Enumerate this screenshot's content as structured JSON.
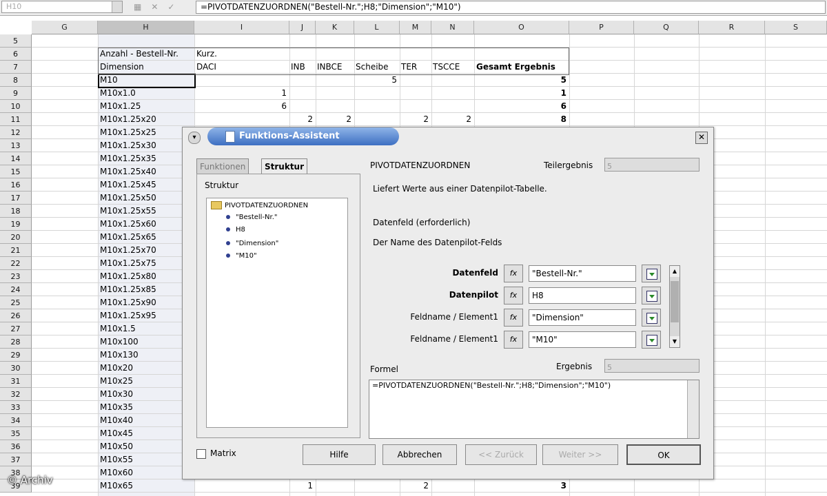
{
  "toolbar": {
    "namebox": "H10",
    "formula": "=PIVOTDATENZUORDNEN(\"Bestell-Nr.\";H8;\"Dimension\";\"M10\")"
  },
  "sheet": {
    "columns": [
      "G",
      "H",
      "I",
      "J",
      "K",
      "L",
      "M",
      "N",
      "O",
      "P",
      "Q",
      "R",
      "S"
    ],
    "rows": [
      "5",
      "6",
      "7",
      "8",
      "9",
      "10",
      "11",
      "12",
      "13",
      "14",
      "15",
      "16",
      "17",
      "18",
      "19",
      "20",
      "21",
      "22",
      "23",
      "24",
      "25",
      "26",
      "27",
      "28",
      "29",
      "30",
      "31",
      "32",
      "33",
      "34",
      "35",
      "36",
      "37",
      "38",
      "39"
    ],
    "h_values": [
      "Anzahl - Bestell-Nr.",
      "Dimension",
      "M10",
      "M10x1.0",
      "M10x1.25",
      "M10x1.25x20",
      "M10x1.25x25",
      "M10x1.25x30",
      "M10x1.25x35",
      "M10x1.25x40",
      "M10x1.25x45",
      "M10x1.25x50",
      "M10x1.25x55",
      "M10x1.25x60",
      "M10x1.25x65",
      "M10x1.25x70",
      "M10x1.25x75",
      "M10x1.25x80",
      "M10x1.25x85",
      "M10x1.25x90",
      "M10x1.25x95",
      "M10x1.5",
      "M10x100",
      "M10x130",
      "M10x20",
      "M10x25",
      "M10x30",
      "M10x35",
      "M10x40",
      "M10x45",
      "M10x50",
      "M10x55",
      "M10x60",
      "M10x65"
    ],
    "pivot_header": {
      "kurz": "Kurz.",
      "daci": "DACI",
      "inb": "INB",
      "inbce": "INBCE",
      "scheibe": "Scheibe",
      "ter": "TER",
      "tscce": "TSCCE",
      "gesamt": "Gesamt Ergebnis"
    },
    "values": {
      "r8_l": "5",
      "r8_o": "5",
      "r9_i": "1",
      "r9_o": "1",
      "r10_i": "6",
      "r10_o": "6",
      "r11_j": "2",
      "r11_k": "2",
      "r11_m": "2",
      "r11_n": "2",
      "r11_o": "8",
      "r39_j": "1",
      "r39_m": "2",
      "r39_o": "3"
    }
  },
  "dialog": {
    "title": "Funktions-Assistent",
    "tab_functions": "Funktionen",
    "tab_structure": "Struktur",
    "structure_label": "Struktur",
    "tree_root": "PIVOTDATENZUORDNEN",
    "tree_items": [
      "\"Bestell-Nr.\"",
      "H8",
      "\"Dimension\"",
      "\"M10\""
    ],
    "function_name": "PIVOTDATENZUORDNEN",
    "teilergebnis_label": "Teilergebnis",
    "teilergebnis_value": "5",
    "description": "Liefert Werte aus einer Datenpilot-Tabelle.",
    "arg_name": "Datenfeld (erforderlich)",
    "arg_desc": "Der Name des Datenpilot-Felds",
    "args": [
      {
        "label": "Datenfeld",
        "value": "\"Bestell-Nr.\""
      },
      {
        "label": "Datenpilot",
        "value": "H8"
      },
      {
        "label": "Feldname / Element1",
        "value": "\"Dimension\""
      },
      {
        "label": "Feldname / Element1",
        "value": "\"M10\""
      }
    ],
    "fx_label": "fx",
    "formel_label": "Formel",
    "ergebnis_label": "Ergebnis",
    "ergebnis_value": "5",
    "formel_value": "=PIVOTDATENZUORDNEN(\"Bestell-Nr.\";H8;\"Dimension\";\"M10\")",
    "matrix_label": "Matrix",
    "btn_help": "Hilfe",
    "btn_cancel": "Abbrechen",
    "btn_back": "<< Zurück",
    "btn_next": "Weiter >>",
    "btn_ok": "OK"
  },
  "watermark": "© Archiv"
}
